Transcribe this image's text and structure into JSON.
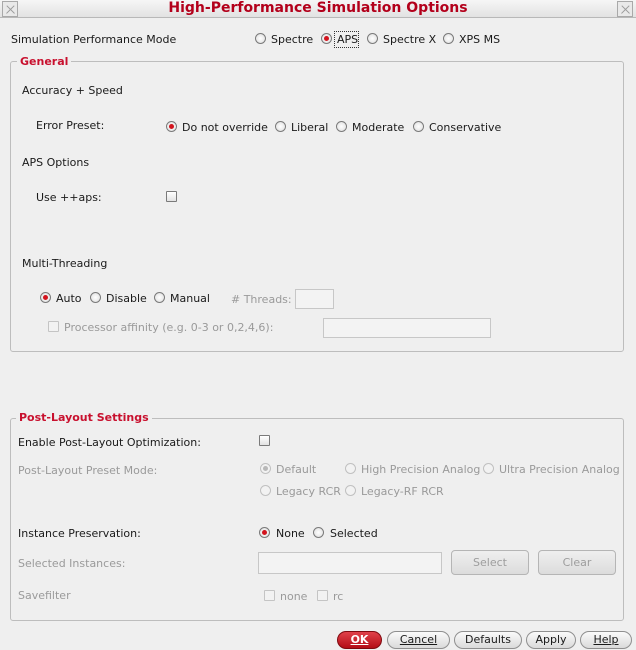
{
  "window": {
    "title": "High-Performance Simulation Options",
    "accent_color": "#c8102e"
  },
  "mode": {
    "label": "Simulation Performance Mode",
    "options": [
      "Spectre",
      "APS",
      "Spectre X",
      "XPS MS"
    ],
    "selected": "APS"
  },
  "general": {
    "title": "General",
    "accuracy_heading": "Accuracy + Speed",
    "error_preset_label": "Error Preset:",
    "error_preset_options": [
      "Do not override",
      "Liberal",
      "Moderate",
      "Conservative"
    ],
    "error_preset_selected": "Do not override",
    "aps_options_heading": "APS Options",
    "use_aps_label": "Use ++aps:",
    "use_aps_checked": false,
    "multithreading_heading": "Multi-Threading",
    "threading_options": [
      "Auto",
      "Disable",
      "Manual"
    ],
    "threading_selected": "Auto",
    "threads_label": "# Threads:",
    "threads_value": "",
    "affinity_label": "Processor affinity (e.g. 0-3 or 0,2,4,6):",
    "affinity_value": ""
  },
  "post_layout": {
    "title": "Post-Layout Settings",
    "enable_label": "Enable Post-Layout Optimization:",
    "enable_checked": false,
    "preset_label": "Post-Layout Preset Mode:",
    "preset_options": [
      "Default",
      "High Precision Analog",
      "Ultra Precision Analog",
      "Legacy RCR",
      "Legacy-RF RCR"
    ],
    "preset_selected": "Default",
    "instance_label": "Instance Preservation:",
    "instance_options": [
      "None",
      "Selected"
    ],
    "instance_selected": "None",
    "selected_instances_label": "Selected Instances:",
    "selected_instances_value": "",
    "select_button": "Select",
    "clear_button": "Clear",
    "savefilter_label": "Savefilter",
    "savefilter_options": [
      "none",
      "rc"
    ]
  },
  "buttons": {
    "ok": "OK",
    "cancel": "Cancel",
    "defaults": "Defaults",
    "apply": "Apply",
    "help": "Help"
  }
}
